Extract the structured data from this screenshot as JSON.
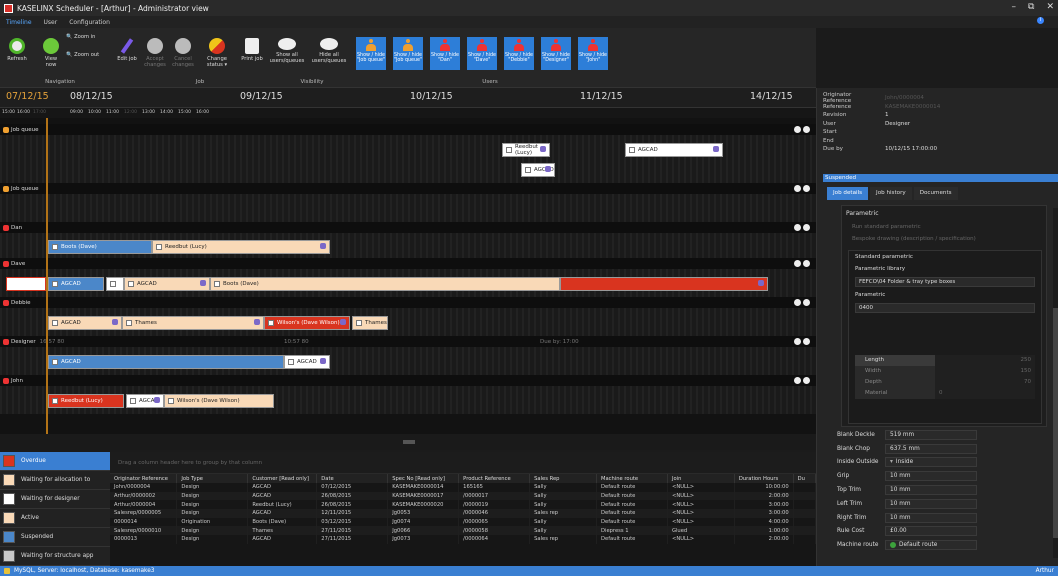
{
  "app": {
    "title": "KASELINX Scheduler - [Arthur] - Administrator view",
    "win_minimize": "–",
    "win_restore": "⧉",
    "win_close": "✕"
  },
  "ribbon_tabs": [
    "Timeline",
    "User",
    "Configuration"
  ],
  "ribbon": {
    "refresh": "Refresh",
    "view_now": "View now",
    "zoom_in": "Zoom in",
    "zoom_out": "Zoom out",
    "edit_job": "Edit job",
    "accept_changes": "Accept changes",
    "cancel_changes": "Cancel changes",
    "change_status": "Change status ▾",
    "print_job": "Print job",
    "show_all": "Show all users/queues",
    "hide_all": "Hide all users/queues",
    "groups": {
      "navigation": "Navigation",
      "job": "Job",
      "visibility": "Visibility",
      "users": "Users"
    },
    "user_toggles": [
      {
        "label": "Show / hide \"Job queue\"",
        "kind": "queue"
      },
      {
        "label": "Show / hide \"Job queue\"",
        "kind": "queue"
      },
      {
        "label": "Show / hide \"Dan\"",
        "kind": "user"
      },
      {
        "label": "Show / hide \"Dave\"",
        "kind": "user"
      },
      {
        "label": "Show / hide \"Debbie\"",
        "kind": "user"
      },
      {
        "label": "Show / hide \"Designer\"",
        "kind": "user"
      },
      {
        "label": "Show / hide \"John\"",
        "kind": "user"
      }
    ]
  },
  "timeline": {
    "dates": [
      "07/12/15",
      "08/12/15",
      "09/12/15",
      "10/12/15",
      "11/12/15",
      "14/12/15"
    ],
    "times": [
      "15:00",
      "16:00",
      "17:00",
      "09:00",
      "10:00",
      "11:00",
      "12:00",
      "13:00",
      "14:00",
      "15:00",
      "16:00"
    ],
    "lanes": [
      {
        "name": "Job queue",
        "icon": "queue"
      },
      {
        "name": "Job queue",
        "icon": "queue"
      },
      {
        "name": "Dan",
        "icon": "user"
      },
      {
        "name": "Dave",
        "icon": "user"
      },
      {
        "name": "Debbie",
        "icon": "user"
      },
      {
        "name": "Designer",
        "icon": "user"
      },
      {
        "name": "John",
        "icon": "user"
      }
    ],
    "jobs": {
      "q1_reedbut": "Reedbut (Lucy)",
      "q1_agcad_a": "AGCAD",
      "q1_agcad_b": "AGCAD",
      "dan_boots": "Boots (Dave)",
      "dan_reedbut": "Reedbut (Lucy)",
      "dave_agcad_a": "AGCAD",
      "dave_agcad_b": "AGCAD",
      "dave_boots": "Boots (Dave)",
      "debbie_agcad": "AGCAD",
      "debbie_thames_a": "Thames",
      "debbie_wilsons": "Wilson's (Dave Wilson)",
      "debbie_thames_b": "Thames",
      "designer_agcad": "AGCAD",
      "john_reedbut": "Reedbut (Lucy)",
      "john_agcad": "AGCAD",
      "john_wilsons": "Wilson's (Dave Wilson)"
    },
    "designer_note_a": "16:57 80",
    "designer_note_b": "10:57 80",
    "designer_note_c": "Due by: 17:00"
  },
  "status_list": [
    {
      "label": "Overdue",
      "color": "#d9341f",
      "selected": true
    },
    {
      "label": "Waiting for allocation to",
      "color": "#f9d9b7",
      "selected": false
    },
    {
      "label": "Waiting for designer",
      "color": "#ffffff",
      "selected": false
    },
    {
      "label": "Active",
      "color": "#f9d9b7",
      "selected": false
    },
    {
      "label": "Suspended",
      "color": "#4b87c9",
      "selected": false
    },
    {
      "label": "Waiting for structure app",
      "color": "#c8c8c8",
      "selected": false
    }
  ],
  "grid": {
    "group_hint": "Drag a column header here to group by that column",
    "columns": [
      "Originator Reference",
      "Job Type",
      "Customer [Read only]",
      "Date",
      "Spec No [Read only]",
      "Product Reference",
      "Sales Rep",
      "Machine route",
      "Join",
      "Duration Hours",
      "Du"
    ],
    "rows": [
      [
        "John/0000004",
        "Design",
        "AGCAD",
        "07/12/2015",
        "KASEMAKE0000014",
        "165165",
        "Sally",
        "Default route",
        "<NULL>",
        "10:00:00"
      ],
      [
        "Arthur/0000002",
        "Design",
        "AGCAD",
        "26/08/2015",
        "KASEMAKE0000017",
        "/0000017",
        "Sally",
        "Default route",
        "<NULL>",
        "2:00:00"
      ],
      [
        "Arthur/0000004",
        "Design",
        "Reedbut (Lucy)",
        "26/08/2015",
        "KASEMAKE0000020",
        "/0000019",
        "Sally",
        "Default route",
        "<NULL>",
        "3:00:00"
      ],
      [
        "Salesrep/0000005",
        "Design",
        "AGCAD",
        "12/11/2015",
        "Jg0053",
        "/0000046",
        "Sales rep",
        "Default route",
        "<NULL>",
        "3:00:00"
      ],
      [
        "0000014",
        "Origination",
        "Boots (Dave)",
        "03/12/2015",
        "Jg0074",
        "/0000065",
        "Sally",
        "Default route",
        "<NULL>",
        "4:00:00"
      ],
      [
        "Salesrep/0000010",
        "Design",
        "Thames",
        "27/11/2015",
        "Jg0066",
        "/0000058",
        "Sally",
        "Diepress 1",
        "Glued",
        "1:00:00"
      ],
      [
        "0000013",
        "Design",
        "AGCAD",
        "27/11/2015",
        "Jg0073",
        "/0000064",
        "Sales rep",
        "Default route",
        "<NULL>",
        "2:00:00"
      ]
    ]
  },
  "details": {
    "originator_reference_label": "Originator Reference",
    "originator_reference_value": "John/0000004",
    "reference_label": "Reference",
    "reference_value": "KASEMAKE0000014",
    "revision_label": "Revision",
    "revision_value": "1",
    "user_label": "User",
    "user_value": "Designer",
    "start_label": "Start",
    "end_label": "End",
    "due_label": "Due by",
    "due_value": "10/12/15 17:00:00",
    "status": "Suspended",
    "tabs": [
      "Job details",
      "Job history",
      "Documents"
    ],
    "parametric": {
      "heading": "Parametric",
      "opt_run": "Run standard parametric",
      "opt_bespoke": "Bespoke drawing (description / specification)",
      "std_heading": "Standard parametric",
      "library_label": "Parametric library",
      "library_value": "FEFCO\\04 Folder & tray type boxes",
      "parametric_label": "Parametric",
      "parametric_value": "0400",
      "dims": [
        {
          "k": "Length",
          "v": "250"
        },
        {
          "k": "Width",
          "v": "150"
        },
        {
          "k": "Depth",
          "v": "70"
        },
        {
          "k": "Material",
          "v": "0"
        }
      ]
    },
    "form": [
      {
        "k": "Blank Deckle",
        "v": "519 mm"
      },
      {
        "k": "Blank Chop",
        "v": "637.5 mm"
      },
      {
        "k": "Inside Outside",
        "v": "Inside"
      },
      {
        "k": "Grip",
        "v": "10 mm"
      },
      {
        "k": "Top Trim",
        "v": "10 mm"
      },
      {
        "k": "Left Trim",
        "v": "10 mm"
      },
      {
        "k": "Right Trim",
        "v": "10 mm"
      },
      {
        "k": "Rule Cost",
        "v": "£0.00"
      },
      {
        "k": "Machine route",
        "v": "Default route"
      }
    ]
  },
  "statusbar": {
    "text": "MySQL, Server: localhost, Database: kasemake3",
    "user": "Arthur"
  }
}
